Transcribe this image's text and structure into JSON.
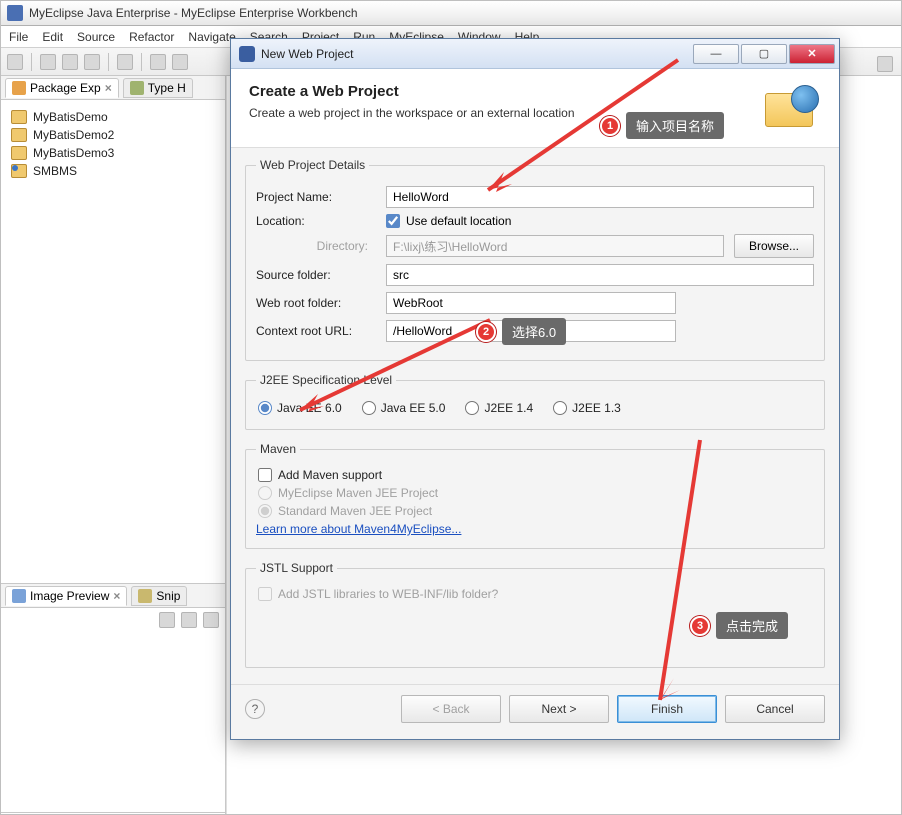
{
  "workbench": {
    "title": "MyEclipse Java Enterprise - MyEclipse Enterprise Workbench",
    "menus": [
      "File",
      "Edit",
      "Source",
      "Refactor",
      "Navigate",
      "Search",
      "Project",
      "Run",
      "MyEclipse",
      "Window",
      "Help"
    ]
  },
  "package_explorer": {
    "tab_label": "Package Exp",
    "secondary_tab_label": "Type H",
    "projects": [
      "MyBatisDemo",
      "MyBatisDemo2",
      "MyBatisDemo3",
      "SMBMS"
    ]
  },
  "image_preview": {
    "tab_label": "Image Preview",
    "secondary_tab_label": "Snip"
  },
  "dialog": {
    "title": "New Web Project",
    "header_title": "Create a Web Project",
    "header_desc": "Create a web project in the workspace or an external location",
    "details": {
      "legend": "Web Project Details",
      "project_name_label": "Project Name:",
      "project_name_value": "HelloWord",
      "location_label": "Location:",
      "use_default_label": "Use default location",
      "directory_label": "Directory:",
      "directory_value": "F:\\lixj\\练习\\HelloWord",
      "browse_label": "Browse...",
      "source_folder_label": "Source folder:",
      "source_folder_value": "src",
      "web_root_label": "Web root folder:",
      "web_root_value": "WebRoot",
      "context_root_label": "Context root URL:",
      "context_root_value": "/HelloWord"
    },
    "j2ee": {
      "legend": "J2EE Specification Level",
      "options": [
        "Java EE 6.0",
        "Java EE 5.0",
        "J2EE 1.4",
        "J2EE 1.3"
      ]
    },
    "maven": {
      "legend": "Maven",
      "add_support": "Add Maven support",
      "opt1": "MyEclipse Maven JEE Project",
      "opt2": "Standard Maven JEE Project",
      "link": "Learn more about Maven4MyEclipse..."
    },
    "jstl": {
      "legend": "JSTL Support",
      "add_label": "Add JSTL libraries to WEB-INF/lib folder?"
    },
    "buttons": {
      "back": "< Back",
      "next": "Next >",
      "finish": "Finish",
      "cancel": "Cancel"
    }
  },
  "annotations": {
    "a1": "输入项目名称",
    "a2": "选择6.0",
    "a3": "点击完成"
  }
}
